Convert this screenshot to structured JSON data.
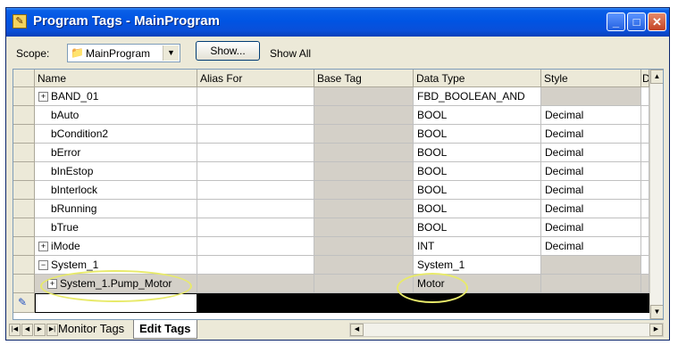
{
  "window": {
    "title": "Program Tags - MainProgram"
  },
  "toolbar": {
    "scope_label": "Scope:",
    "scope_value": "MainProgram",
    "show_button": "Show...",
    "show_status": "Show All"
  },
  "columns": [
    "Name",
    "Alias For",
    "Base Tag",
    "Data Type",
    "Style",
    "D"
  ],
  "rows": [
    {
      "name": "BAND_01",
      "alias": "",
      "base": "",
      "type": "FBD_BOOLEAN_AND",
      "style": "",
      "expander": "+"
    },
    {
      "name": "bAuto",
      "alias": "",
      "base": "",
      "type": "BOOL",
      "style": "Decimal",
      "expander": ""
    },
    {
      "name": "bCondition2",
      "alias": "",
      "base": "",
      "type": "BOOL",
      "style": "Decimal",
      "expander": ""
    },
    {
      "name": "bError",
      "alias": "",
      "base": "",
      "type": "BOOL",
      "style": "Decimal",
      "expander": ""
    },
    {
      "name": "bInEstop",
      "alias": "",
      "base": "",
      "type": "BOOL",
      "style": "Decimal",
      "expander": ""
    },
    {
      "name": "bInterlock",
      "alias": "",
      "base": "",
      "type": "BOOL",
      "style": "Decimal",
      "expander": ""
    },
    {
      "name": "bRunning",
      "alias": "",
      "base": "",
      "type": "BOOL",
      "style": "Decimal",
      "expander": ""
    },
    {
      "name": "bTrue",
      "alias": "",
      "base": "",
      "type": "BOOL",
      "style": "Decimal",
      "expander": ""
    },
    {
      "name": "iMode",
      "alias": "",
      "base": "",
      "type": "INT",
      "style": "Decimal",
      "expander": "+"
    },
    {
      "name": "System_1",
      "alias": "",
      "base": "",
      "type": "System_1",
      "style": "",
      "expander": "−"
    },
    {
      "name": "System_1.Pump_Motor",
      "alias": "",
      "base": "",
      "type": "Motor",
      "style": "",
      "expander": "+"
    }
  ],
  "tabs": {
    "monitor": "Monitor Tags",
    "edit": "Edit Tags"
  },
  "colors": {
    "highlight_ellipse": "#e8ea6a",
    "titlebar": "#0054e3"
  }
}
